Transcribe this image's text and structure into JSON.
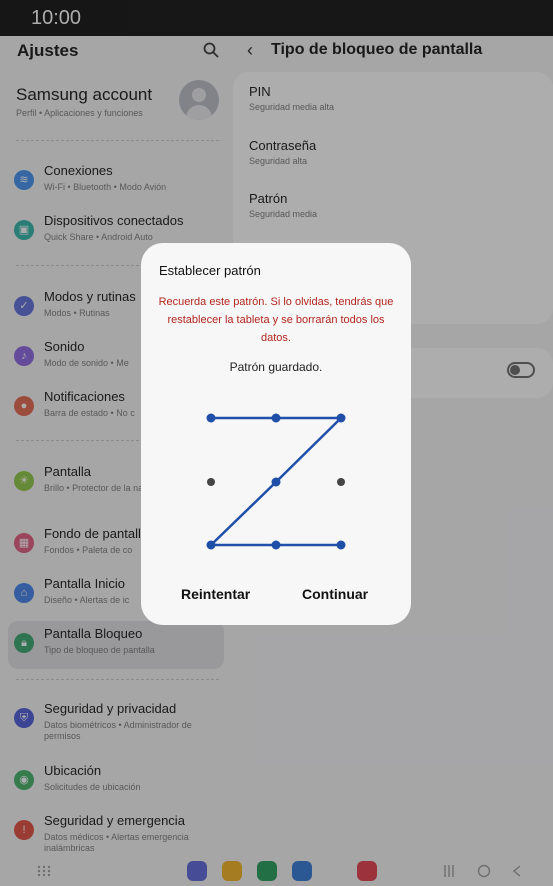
{
  "status": {
    "time": "10:00"
  },
  "left": {
    "title": "Ajustes",
    "account": {
      "title": "Samsung account",
      "subtitle": "Perfil  •  Aplicaciones y funciones"
    },
    "items": [
      {
        "title": "Conexiones",
        "subtitle": "Wi-Fi  •  Bluetooth  •  Modo Avión",
        "color": "#3d8ef0"
      },
      {
        "title": "Dispositivos conectados",
        "subtitle": "Quick Share  •  Android Auto",
        "color": "#2bb3a6"
      },
      {
        "title": "Modos y rutinas",
        "subtitle": "Modos  •  Rutinas",
        "color": "#5b6bd9"
      },
      {
        "title": "Sonido",
        "subtitle": "Modo de sonido  •  Me",
        "color": "#8a63e0"
      },
      {
        "title": "Notificaciones",
        "subtitle": "Barra de estado  •  No c",
        "color": "#e4634b"
      },
      {
        "title": "Pantalla",
        "subtitle": "Brillo  •  Protector de la navegación",
        "color": "#8cc63f"
      },
      {
        "title": "Fondo de pantall",
        "subtitle": "Fondos  •  Paleta de co",
        "color": "#e0577b"
      },
      {
        "title": "Pantalla Inicio",
        "subtitle": "Diseño  •  Alertas de ic",
        "color": "#3f7ee8"
      },
      {
        "title": "Pantalla Bloqueo",
        "subtitle": "Tipo de bloqueo de pantalla",
        "color": "#34a46b"
      },
      {
        "title": "Seguridad y privacidad",
        "subtitle": "Datos biométricos  •  Administrador de permisos",
        "color": "#4a57d6"
      },
      {
        "title": "Ubicación",
        "subtitle": "Solicitudes de ubicación",
        "color": "#3fae63"
      },
      {
        "title": "Seguridad y emergencia",
        "subtitle": "Datos médicos  •  Alertas emergencia inalámbricas",
        "color": "#e14a3b"
      }
    ]
  },
  "right": {
    "title": "Tipo de bloqueo de pantalla",
    "options": [
      {
        "title": "PIN",
        "subtitle": "Seguridad media alta"
      },
      {
        "title": "Contraseña",
        "subtitle": "Seguridad alta"
      },
      {
        "title": "Patrón",
        "subtitle": "Seguridad media"
      }
    ]
  },
  "dialog": {
    "title": "Establecer patrón",
    "warning": "Recuerda este patrón. Si lo olvidas, tendrás que restablecer la tableta y se borrarán todos los datos.",
    "status": "Patrón guardado.",
    "retry_label": "Reintentar",
    "continue_label": "Continuar",
    "pattern_sequence": [
      1,
      2,
      3,
      5,
      7,
      8,
      9
    ],
    "line_color": "#1f4fa8"
  },
  "navbar": {
    "apps": [
      {
        "icon": "messages-icon",
        "color": "#5a63d8"
      },
      {
        "icon": "my-files-icon",
        "color": "#f2b21c"
      },
      {
        "icon": "app-c-icon",
        "color": "#1f9b5a"
      },
      {
        "icon": "chat-icon",
        "color": "#2e74d6"
      },
      {
        "icon": "video-icon",
        "color": "#e3394a"
      }
    ]
  }
}
